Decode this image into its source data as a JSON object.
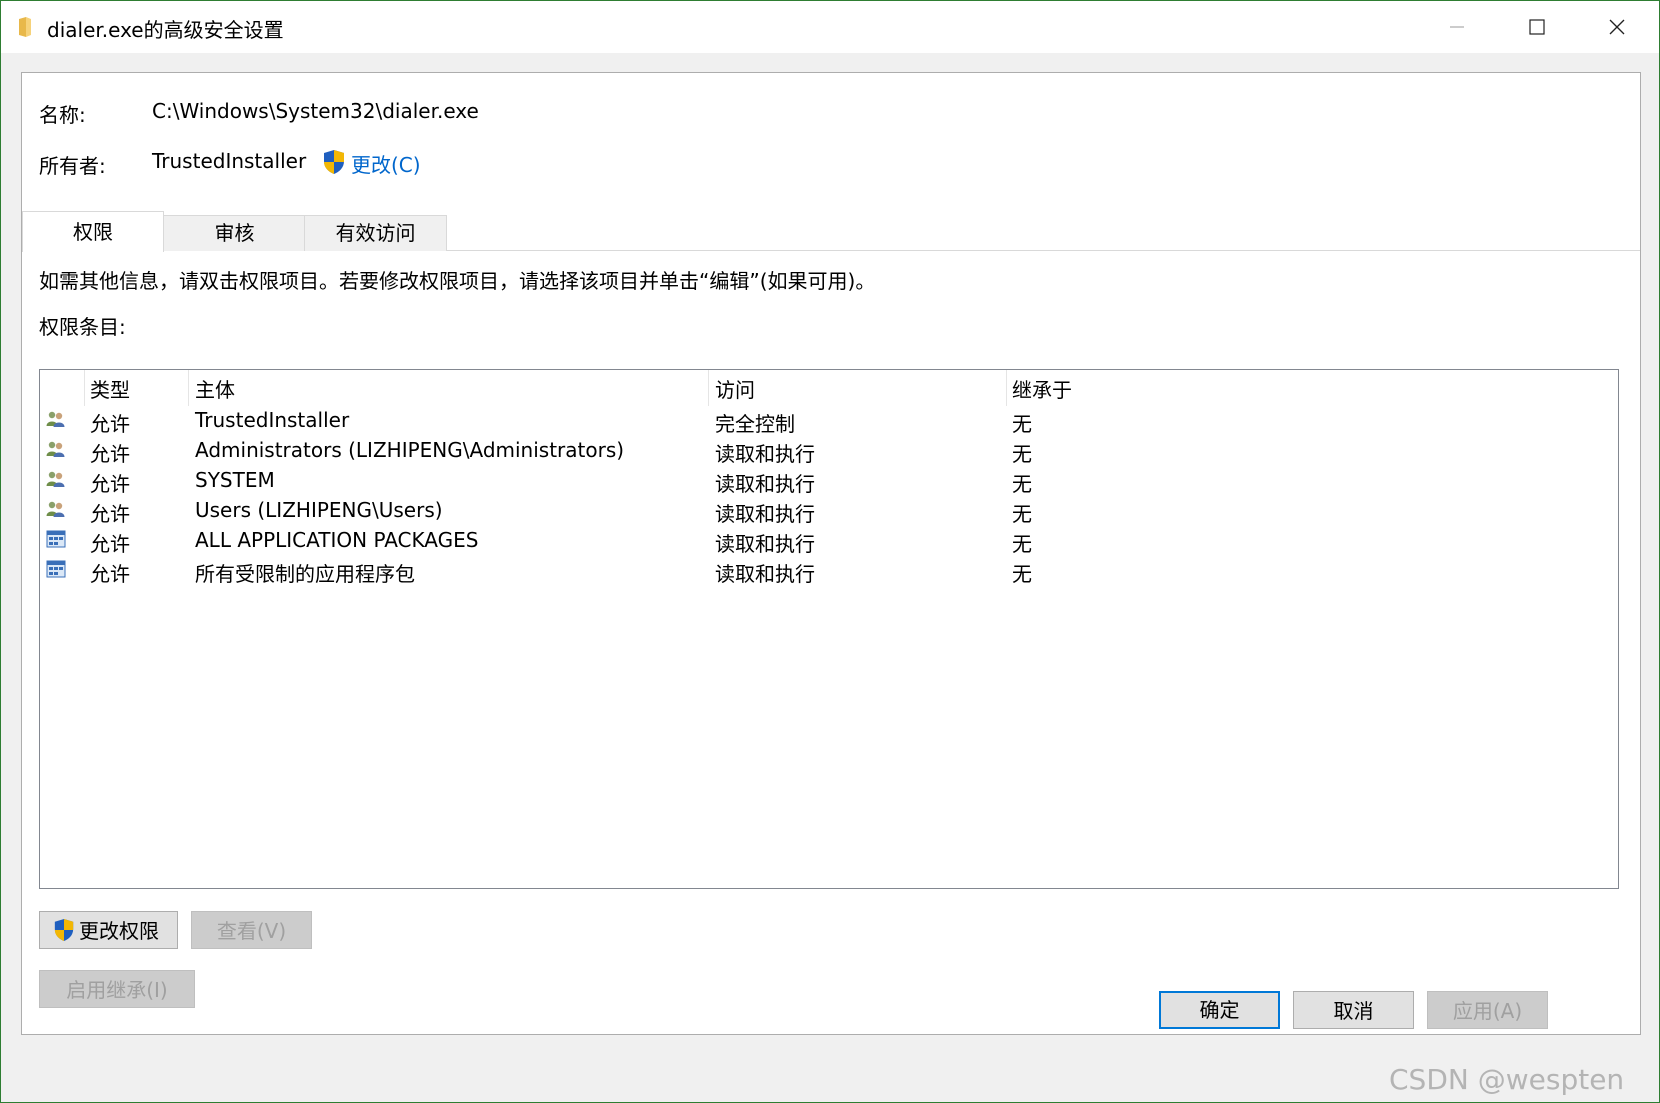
{
  "window": {
    "title": "dialer.exe的高级安全设置",
    "controls": {
      "minimize": "—",
      "maximize": "☐",
      "close": "✕"
    }
  },
  "info": {
    "name_label": "名称:",
    "name_value": "C:\\Windows\\System32\\dialer.exe",
    "owner_label": "所有者:",
    "owner_value": "TrustedInstaller",
    "change_owner_link": "更改(C)"
  },
  "tabs": [
    {
      "label": "权限",
      "active": true
    },
    {
      "label": "审核",
      "active": false
    },
    {
      "label": "有效访问",
      "active": false
    }
  ],
  "permissions": {
    "description": "如需其他信息，请双击权限项目。若要修改权限项目，请选择该项目并单击“编辑”(如果可用)。",
    "entries_label": "权限条目:",
    "columns": [
      "类型",
      "主体",
      "访问",
      "继承于"
    ],
    "rows": [
      {
        "icon": "users-group-icon",
        "type": "允许",
        "principal": "TrustedInstaller",
        "access": "完全控制",
        "inherited": "无"
      },
      {
        "icon": "users-group-icon",
        "type": "允许",
        "principal": "Administrators (LIZHIPENG\\Administrators)",
        "access": "读取和执行",
        "inherited": "无"
      },
      {
        "icon": "users-group-icon",
        "type": "允许",
        "principal": "SYSTEM",
        "access": "读取和执行",
        "inherited": "无"
      },
      {
        "icon": "users-group-icon",
        "type": "允许",
        "principal": "Users (LIZHIPENG\\Users)",
        "access": "读取和执行",
        "inherited": "无"
      },
      {
        "icon": "app-package-icon",
        "type": "允许",
        "principal": "ALL APPLICATION PACKAGES",
        "access": "读取和执行",
        "inherited": "无"
      },
      {
        "icon": "app-package-icon",
        "type": "允许",
        "principal": "所有受限制的应用程序包",
        "access": "读取和执行",
        "inherited": "无"
      }
    ]
  },
  "buttons": {
    "change_permissions": "更改权限",
    "view": "查看(V)",
    "enable_inheritance": "启用继承(I)",
    "ok": "确定",
    "cancel": "取消",
    "apply": "应用(A)"
  },
  "watermark": "CSDN @wespten",
  "colors": {
    "link": "#0066cc",
    "shield_blue": "#1f5fbf",
    "shield_yellow": "#f2b705",
    "default_button_border": "#0078d7"
  }
}
